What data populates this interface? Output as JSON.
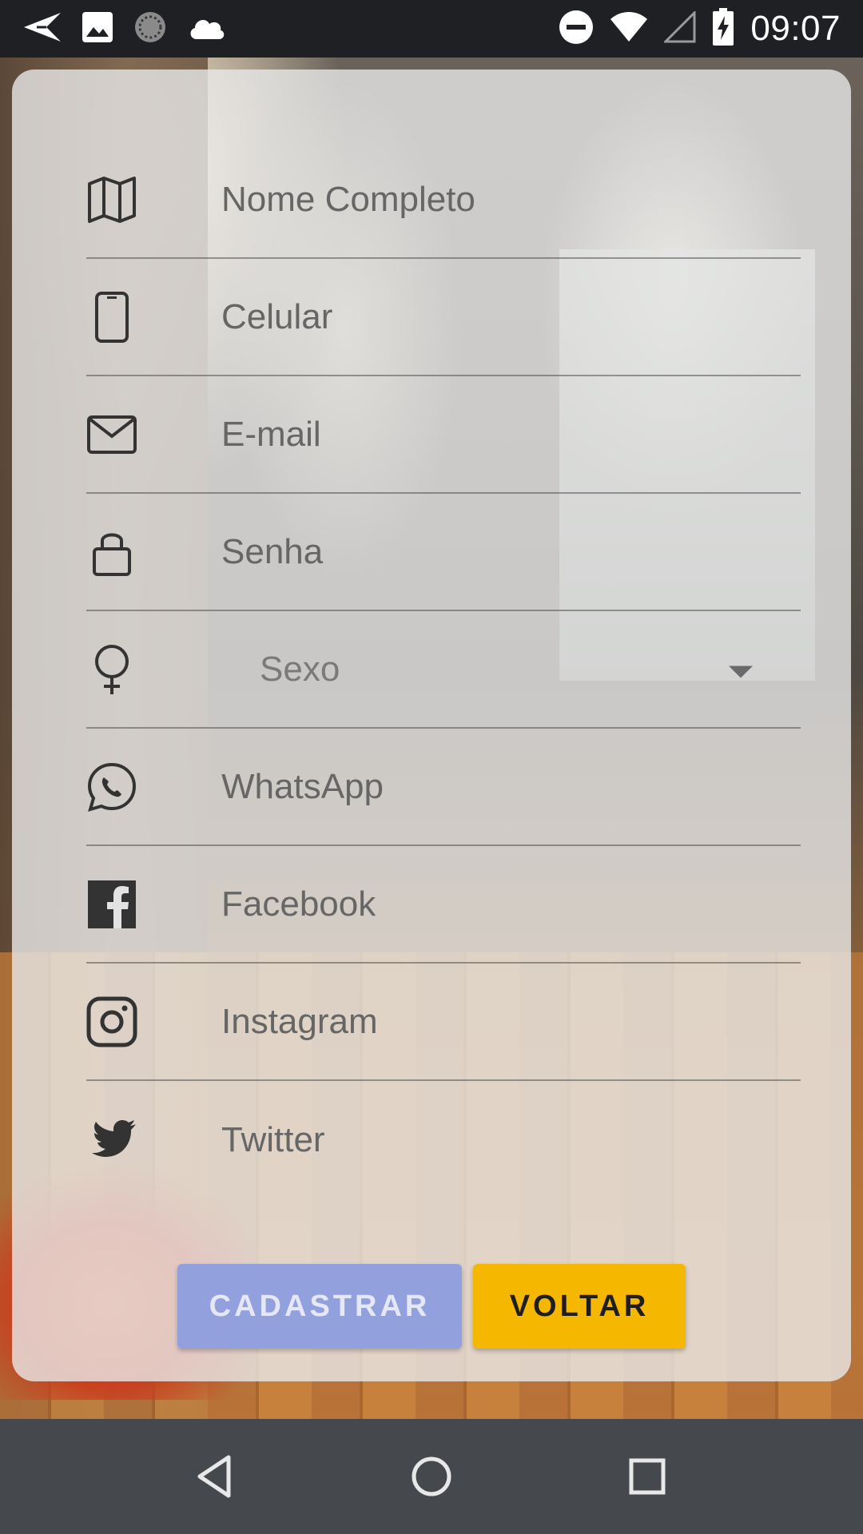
{
  "status_bar": {
    "time": "09:07",
    "left_icons": [
      "send-icon",
      "image-icon",
      "sync-icon",
      "cloud-icon"
    ],
    "right_icons": [
      "do-not-disturb-icon",
      "wifi-icon",
      "signal-icon",
      "battery-charging-icon"
    ]
  },
  "form": {
    "fields": [
      {
        "icon": "map-icon",
        "placeholder": "Nome Completo"
      },
      {
        "icon": "phone-icon",
        "placeholder": "Celular"
      },
      {
        "icon": "mail-icon",
        "placeholder": "E-mail"
      },
      {
        "icon": "lock-icon",
        "placeholder": "Senha"
      },
      {
        "icon": "female-icon",
        "select_label": "Sexo"
      },
      {
        "icon": "whatsapp-icon",
        "placeholder": "WhatsApp"
      },
      {
        "icon": "facebook-icon",
        "placeholder": "Facebook"
      },
      {
        "icon": "instagram-icon",
        "placeholder": "Instagram"
      },
      {
        "icon": "twitter-icon",
        "placeholder": "Twitter"
      }
    ]
  },
  "buttons": {
    "register_label": "CADASTRAR",
    "back_label": "VOLTAR"
  },
  "colors": {
    "register_button": "#8e9fe0",
    "back_button": "#f5b700",
    "card_background": "#e8e8e8",
    "nav_bar": "#45494e",
    "status_bar": "#1f2023"
  }
}
